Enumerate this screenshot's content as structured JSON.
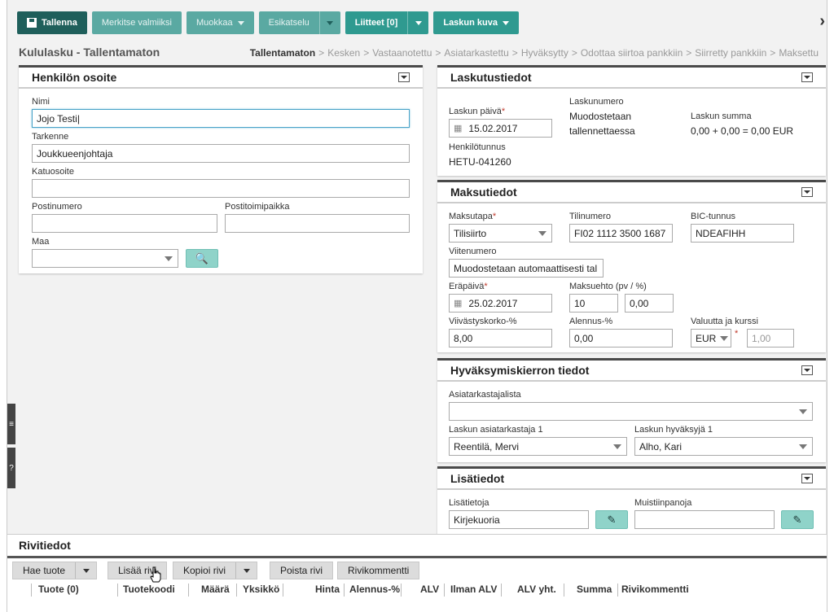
{
  "toolbar": {
    "save": "Tallenna",
    "mark_ready": "Merkitse valmiiksi",
    "edit": "Muokkaa",
    "preview": "Esikatselu",
    "attachments": "Liitteet [0]",
    "invoice_image": "Laskun kuva"
  },
  "page": {
    "title": "Kululasku - Tallentamaton",
    "breadcrumb": [
      "Tallentamaton",
      "Kesken",
      "Vastaanotettu",
      "Asiatarkastettu",
      "Hyväksytty",
      "Odottaa siirtoa pankkiin",
      "Siirretty pankkiin",
      "Maksettu"
    ]
  },
  "address": {
    "title": "Henkilön osoite",
    "name_label": "Nimi",
    "name_value": "Jojo Testi",
    "spec_label": "Tarkenne",
    "spec_value": "Joukkueenjohtaja",
    "street_label": "Katuosoite",
    "street_value": "",
    "zip_label": "Postinumero",
    "zip_value": "",
    "city_label": "Postitoimipaikka",
    "city_value": "",
    "country_label": "Maa",
    "country_value": ""
  },
  "billing": {
    "title": "Laskutustiedot",
    "date_label": "Laskun päivä",
    "date_value": "15.02.2017",
    "number_label": "Laskunumero",
    "number_value_1": "Muodostetaan",
    "number_value_2": "tallennettaessa",
    "sum_label": "Laskun summa",
    "sum_value": "0,00 + 0,00 = 0,00 EUR",
    "ssn_label": "Henkilötunnus",
    "ssn_value": "HETU-041260"
  },
  "payment": {
    "title": "Maksutiedot",
    "method_label": "Maksutapa",
    "method_value": "Tilisiirto",
    "account_label": "Tilinumero",
    "account_value": "FI02 1112 3500 1687",
    "bic_label": "BIC-tunnus",
    "bic_value": "NDEAFIHH",
    "ref_label": "Viitenumero",
    "ref_value": "Muodostetaan automaattisesti tal",
    "due_label": "Eräpäivä",
    "due_value": "25.02.2017",
    "terms_label": "Maksuehto (pv / %)",
    "terms_days": "10",
    "terms_pct": "0,00",
    "interest_label": "Viivästyskorko-%",
    "interest_value": "8,00",
    "discount_label": "Alennus-%",
    "discount_value": "0,00",
    "currency_label": "Valuutta ja kurssi",
    "currency_value": "EUR",
    "rate_value": "1,00"
  },
  "approval": {
    "title": "Hyväksymiskierron tiedot",
    "list_label": "Asiatarkastajalista",
    "list_value": "",
    "inspector_label": "Laskun asiatarkastaja 1",
    "inspector_value": "Reentilä, Mervi",
    "approver_label": "Laskun hyväksyjä 1",
    "approver_value": "Alho, Kari"
  },
  "extra": {
    "title": "Lisätiedot",
    "info_label": "Lisätietoja",
    "info_value": "Kirjekuoria",
    "notes_label": "Muistiinpanoja",
    "notes_value": ""
  },
  "rows": {
    "title": "Rivitiedot",
    "fetch": "Hae tuote",
    "add": "Lisää rivi",
    "copy": "Kopioi rivi",
    "delete": "Poista rivi",
    "comment": "Rivikommentti",
    "columns": [
      "Tuote (0)",
      "Tuotekoodi",
      "Määrä",
      "Yksikkö",
      "Hinta",
      "Alennus-%",
      "ALV",
      "Ilman ALV",
      "ALV yht.",
      "Summa",
      "Rivikommentti"
    ]
  }
}
